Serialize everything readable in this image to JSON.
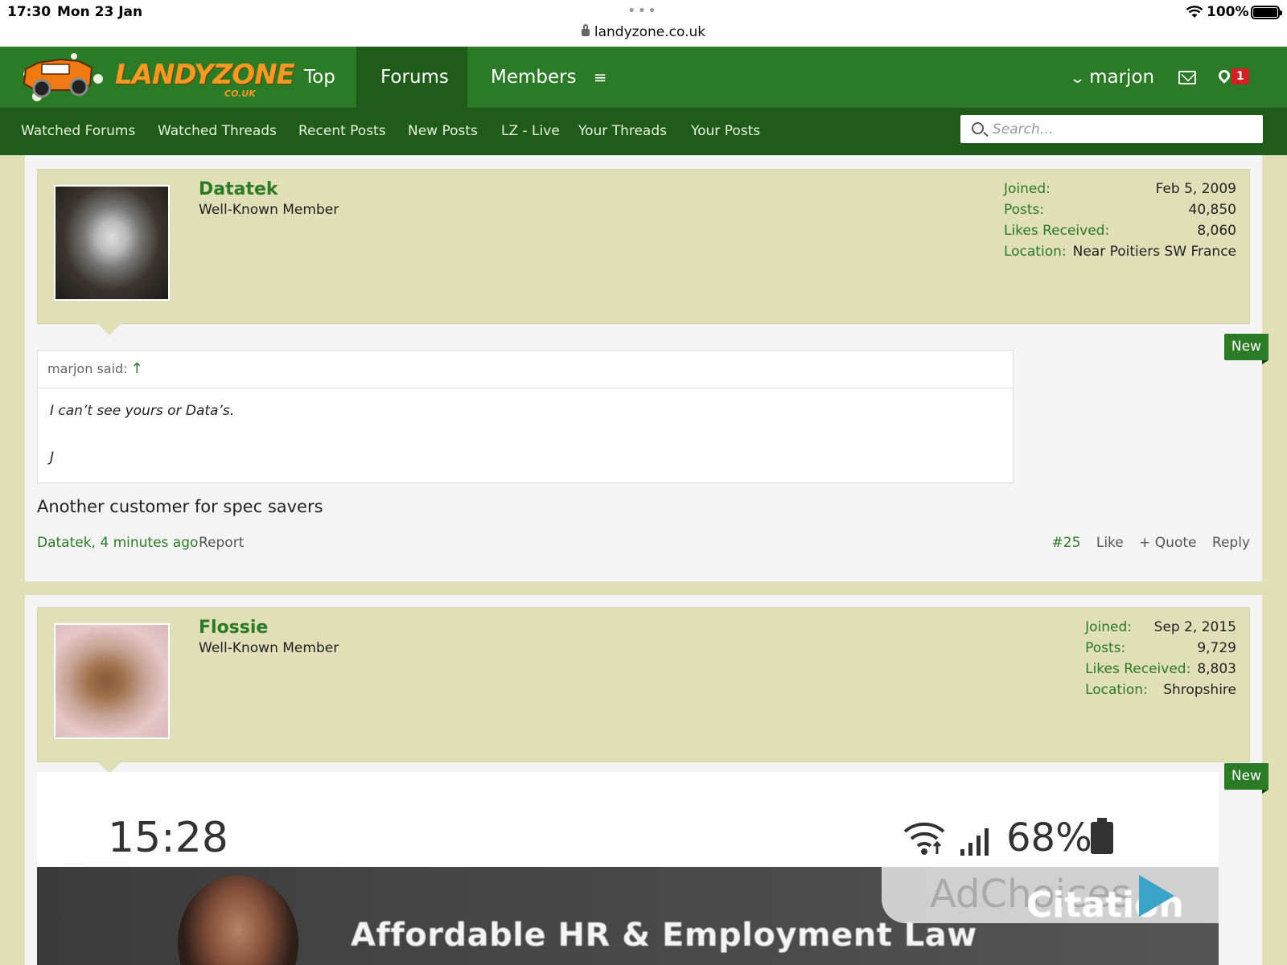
{
  "statusbar": {
    "time": "17:30",
    "date": "Mon 23 Jan",
    "url": "landyzone.co.uk",
    "battery": "100%"
  },
  "header": {
    "logo_text": "LANDYZONE",
    "logo_sub": "CO.UK",
    "tabs": [
      {
        "label": "Top"
      },
      {
        "label": "Forums"
      },
      {
        "label": "Members"
      }
    ],
    "user": "marjon",
    "alert_count": "1"
  },
  "subnav": {
    "items": [
      {
        "label": "Watched Forums"
      },
      {
        "label": "Watched Threads"
      },
      {
        "label": "Recent Posts"
      },
      {
        "label": "New Posts"
      },
      {
        "label": "LZ - Live"
      },
      {
        "label": "Your Threads"
      },
      {
        "label": "Your Posts"
      }
    ],
    "search_placeholder": "Search…"
  },
  "posts": [
    {
      "username": "Datatek",
      "user_title": "Well-Known Member",
      "stats": [
        {
          "label": "Joined:",
          "value": "Feb 5, 2009"
        },
        {
          "label": "Posts:",
          "value": "40,850"
        },
        {
          "label": "Likes Received:",
          "value": "8,060"
        },
        {
          "label": "Location:",
          "value": "Near Poitiers SW France"
        }
      ],
      "new_label": "New",
      "quote": {
        "author": "marjon said:",
        "arrow": "↑",
        "lines": [
          "I can’t see yours or Data’s.",
          "J"
        ]
      },
      "message": "Another customer for spec savers",
      "footer": {
        "author_time": "Datatek, 4 minutes ago",
        "report": "Report",
        "number": "#25",
        "like": "Like",
        "quote": "+ Quote",
        "reply": "Reply"
      }
    },
    {
      "username": "Flossie",
      "user_title": "Well-Known Member",
      "stats": [
        {
          "label": "Joined:",
          "value": "Sep 2, 2015"
        },
        {
          "label": "Posts:",
          "value": "9,729"
        },
        {
          "label": "Likes Received:",
          "value": "8,803"
        },
        {
          "label": "Location:",
          "value": "Shropshire"
        }
      ],
      "new_label": "New",
      "embed": {
        "time": "15:28",
        "battery": "68%",
        "ad_headline": "Affordable HR & Employment Law",
        "ad_choices": "AdChoices",
        "ad_brand": "Citation"
      }
    }
  ],
  "colors": {
    "brand_green": "#2a7a26",
    "dark_green": "#1f5c19",
    "logo_orange": "#f29b24",
    "alert_red": "#d42020"
  }
}
